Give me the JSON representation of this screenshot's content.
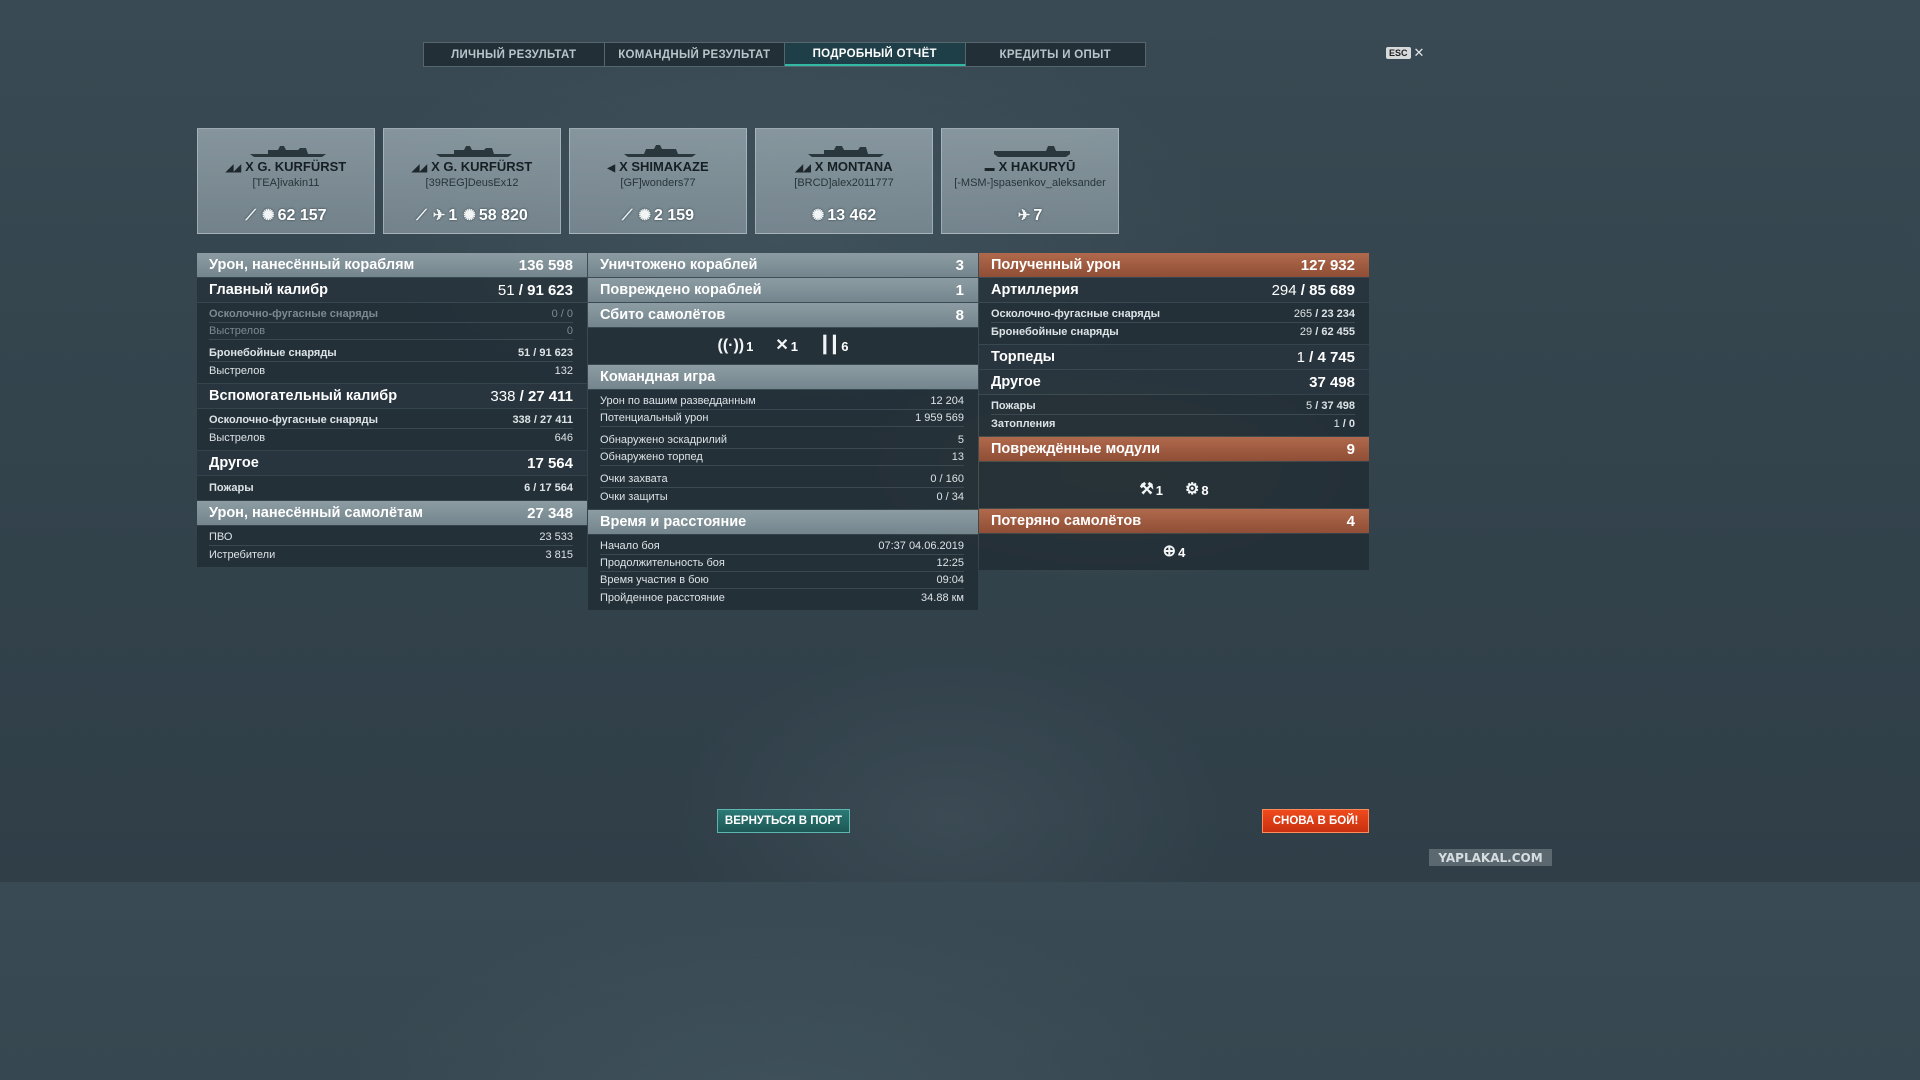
{
  "tabs": [
    {
      "label": "ЛИЧНЫЙ РЕЗУЛЬТАТ",
      "active": false
    },
    {
      "label": "КОМАНДНЫЙ РЕЗУЛЬТАТ",
      "active": false
    },
    {
      "label": "ПОДРОБНЫЙ ОТЧЁТ",
      "active": true
    },
    {
      "label": "КРЕДИТЫ И ОПЫТ",
      "active": false
    }
  ],
  "esc": {
    "key": "ESC",
    "close": "✕"
  },
  "cards": [
    {
      "tier": "X",
      "ship": "G. KURFÜRST",
      "player": "[TEA]ivakin11",
      "class_icon": "battleship-icon",
      "stats": [
        {
          "icon": "torpedo-hit-icon",
          "value": ""
        },
        {
          "icon": "damage-burst-icon",
          "value": "62 157"
        }
      ]
    },
    {
      "tier": "X",
      "ship": "G. KURFÜRST",
      "player": "[39REG]DeusEx12",
      "class_icon": "battleship-icon",
      "stats": [
        {
          "icon": "torpedo-hit-icon",
          "value": ""
        },
        {
          "icon": "plane-kill-icon",
          "value": "1"
        },
        {
          "icon": "damage-burst-icon",
          "value": "58 820"
        }
      ]
    },
    {
      "tier": "X",
      "ship": "SHIMAKAZE",
      "player": "[GF]wonders77",
      "class_icon": "destroyer-icon",
      "stats": [
        {
          "icon": "torpedo-hit-icon",
          "value": ""
        },
        {
          "icon": "damage-burst-icon",
          "value": "2 159"
        }
      ]
    },
    {
      "tier": "X",
      "ship": "MONTANA",
      "player": "[BRCD]alex2011777",
      "class_icon": "battleship-icon",
      "stats": [
        {
          "icon": "damage-burst-icon",
          "value": "13 462"
        }
      ]
    },
    {
      "tier": "X",
      "ship": "HAKURYŪ",
      "player": "[-MSM-]spasenkov_aleksander",
      "class_icon": "carrier-icon",
      "stats": [
        {
          "icon": "plane-kill-icon",
          "value": "7"
        }
      ]
    }
  ],
  "col1": {
    "damage_ships": {
      "label": "Урон, нанесённый кораблям",
      "value": "136 598"
    },
    "main_battery": {
      "label": "Главный калибр",
      "hits": "51",
      "value": "91 623"
    },
    "main_rows": [
      {
        "label": "Осколочно-фугасные снаряды",
        "value": "0 / 0",
        "dim": true,
        "bold": true,
        "gap": false
      },
      {
        "label": "Выстрелов",
        "value": "0",
        "dim": true,
        "bold": false,
        "gap": false
      },
      {
        "label": "Бронебойные снаряды",
        "value": "51 / 91 623",
        "dim": false,
        "bold": true,
        "gap": true
      },
      {
        "label": "Выстрелов",
        "value": "132",
        "dim": false,
        "bold": false,
        "gap": false
      }
    ],
    "secondary": {
      "label": "Вспомогательный калибр",
      "hits": "338",
      "value": "27 411"
    },
    "secondary_rows": [
      {
        "label": "Осколочно-фугасные снаряды",
        "value": "338 / 27 411",
        "bold": true
      },
      {
        "label": "Выстрелов",
        "value": "646",
        "bold": false
      }
    ],
    "other": {
      "label": "Другое",
      "value": "17 564"
    },
    "other_rows": [
      {
        "label": "Пожары",
        "value": "6 / 17 564"
      }
    ],
    "damage_planes": {
      "label": "Урон, нанесённый самолётам",
      "value": "27 348"
    },
    "plane_rows": [
      {
        "label": "ПВО",
        "value": "23 533"
      },
      {
        "label": "Истребители",
        "value": "3 815"
      }
    ]
  },
  "col2": {
    "destroyed": {
      "label": "Уничтожено кораблей",
      "value": "3"
    },
    "damaged": {
      "label": "Повреждено кораблей",
      "value": "1"
    },
    "planes_shot": {
      "label": "Сбито самолётов",
      "value": "8"
    },
    "plane_icons": [
      {
        "icon": "radar-spot-icon",
        "value": "1"
      },
      {
        "icon": "plane-shot-icon",
        "value": "1"
      },
      {
        "icon": "aa-guns-icon",
        "value": "6"
      }
    ],
    "team": {
      "label": "Командная игра"
    },
    "team_rows": [
      {
        "label": "Урон по вашим разведданным",
        "value": "12 204",
        "gap": false
      },
      {
        "label": "Потенциальный урон",
        "value": "1 959 569",
        "gap": false
      },
      {
        "label": "Обнаружено эскадрилий",
        "value": "5",
        "gap": true
      },
      {
        "label": "Обнаружено торпед",
        "value": "13",
        "gap": false
      },
      {
        "label": "Очки захвата",
        "value": "0 / 160",
        "gap": true
      },
      {
        "label": "Очки защиты",
        "value": "0 / 34",
        "gap": false
      }
    ],
    "time": {
      "label": "Время и расстояние"
    },
    "time_rows": [
      {
        "label": "Начало боя",
        "value": "07:37  04.06.2019"
      },
      {
        "label": "Продолжительность боя",
        "value": "12:25"
      },
      {
        "label": "Время участия в бою",
        "value": "09:04"
      },
      {
        "label": "Пройденное расстояние",
        "value": "34.88 км"
      }
    ]
  },
  "col3": {
    "received": {
      "label": "Полученный урон",
      "value": "127 932"
    },
    "artillery": {
      "label": "Артиллерия",
      "hits": "294",
      "value": "85 689"
    },
    "artillery_rows": [
      {
        "label": "Осколочно-фугасные снаряды",
        "hits": "265",
        "value": "23 234"
      },
      {
        "label": "Бронебойные снаряды",
        "hits": "29",
        "value": "62 455"
      }
    ],
    "torpedoes": {
      "label": "Торпеды",
      "hits": "1",
      "value": "4 745"
    },
    "other": {
      "label": "Другое",
      "value": "37 498"
    },
    "other_rows": [
      {
        "label": "Пожары",
        "hits": "5",
        "value": "37 498"
      },
      {
        "label": "Затопления",
        "hits": "1",
        "value": "0"
      }
    ],
    "modules": {
      "label": "Повреждённые модули",
      "value": "9"
    },
    "module_icons": [
      {
        "icon": "steering-gear-icon",
        "value": "1"
      },
      {
        "icon": "gun-turret-icon",
        "value": "8"
      }
    ],
    "planes_lost": {
      "label": "Потеряно самолётов",
      "value": "4"
    },
    "planes_lost_icons": [
      {
        "icon": "crosshair-icon",
        "value": "4"
      }
    ]
  },
  "buttons": {
    "port": "ВЕРНУТЬСЯ В ПОРТ",
    "battle": "СНОВА В БОЙ!"
  },
  "watermark": "YAPLAKAL.COM",
  "colors": {
    "accent": "#32b9a4",
    "battle_button": "#e2401a",
    "received_header": "#a05c42"
  }
}
